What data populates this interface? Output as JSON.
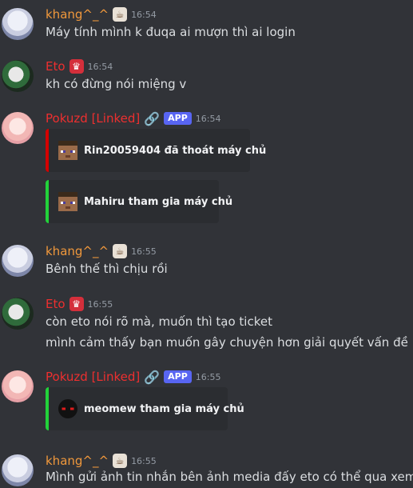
{
  "messages": [
    {
      "author": "khang^_^",
      "time": "16:54",
      "lines": [
        "Máy tính mình k đuqa ai mượn thì ai login"
      ]
    },
    {
      "author": "Eto",
      "time": "16:54",
      "lines": [
        "kh có đừng nói miệng v"
      ]
    },
    {
      "author": "Pokuzd [Linked]",
      "app_badge": "APP",
      "time": "16:54",
      "embeds": [
        "Rin20059404 đã thoát máy chủ",
        "Mahiru tham gia máy chủ"
      ]
    },
    {
      "author": "khang^_^",
      "time": "16:55",
      "lines": [
        "Bênh thế thì chịu rồi"
      ]
    },
    {
      "author": "Eto",
      "time": "16:55",
      "lines": [
        "còn eto nói rõ mà, muốn thì tạo ticket",
        "mình cảm thấy bạn muốn gây chuyện hơn giải quyết vấn đề"
      ]
    },
    {
      "author": "Pokuzd [Linked]",
      "app_badge": "APP",
      "time": "16:55",
      "embeds": [
        "meomew tham gia máy chủ"
      ]
    },
    {
      "author": "khang^_^",
      "time": "16:55",
      "lines": [
        "Mình gửi ảnh tin nhắn bên ảnh media đấy eto có thể qua xem"
      ]
    }
  ],
  "icons": {
    "khang_badge": "coffee-icon",
    "eto_badge": "crown-icon",
    "pokuzd_badge": "link-icon"
  },
  "colors": {
    "background": "#313338",
    "embed_bg": "#2b2d31",
    "name_orange": "#f0983c",
    "name_red": "#ed2f2f",
    "app_badge": "#5865f2",
    "leave_bar": "#d40000",
    "join_bar": "#22d23a"
  }
}
